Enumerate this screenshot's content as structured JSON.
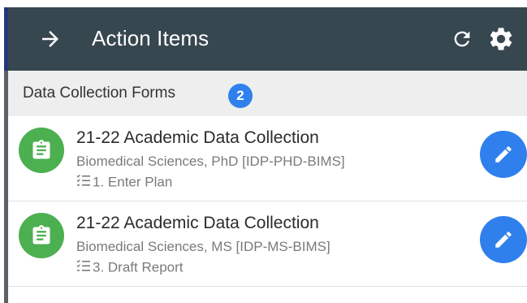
{
  "header": {
    "title": "Action Items",
    "back_icon": "arrow-right-icon",
    "refresh_icon": "refresh-icon",
    "settings_icon": "gear-icon",
    "background": "#37474f"
  },
  "section": {
    "label": "Data Collection Forms",
    "count": "2",
    "badge_color": "#2f80ed"
  },
  "items": [
    {
      "title": "21-22 Academic Data Collection",
      "program": "Biomedical Sciences, PhD [IDP-PHD-BIMS]",
      "step": "1. Enter Plan",
      "icon": "clipboard-icon",
      "icon_color": "#4caf50",
      "action_icon": "pencil-icon"
    },
    {
      "title": "21-22 Academic Data Collection",
      "program": "Biomedical Sciences, MS [IDP-MS-BIMS]",
      "step": "3. Draft Report",
      "icon": "clipboard-icon",
      "icon_color": "#4caf50",
      "action_icon": "pencil-icon"
    }
  ]
}
